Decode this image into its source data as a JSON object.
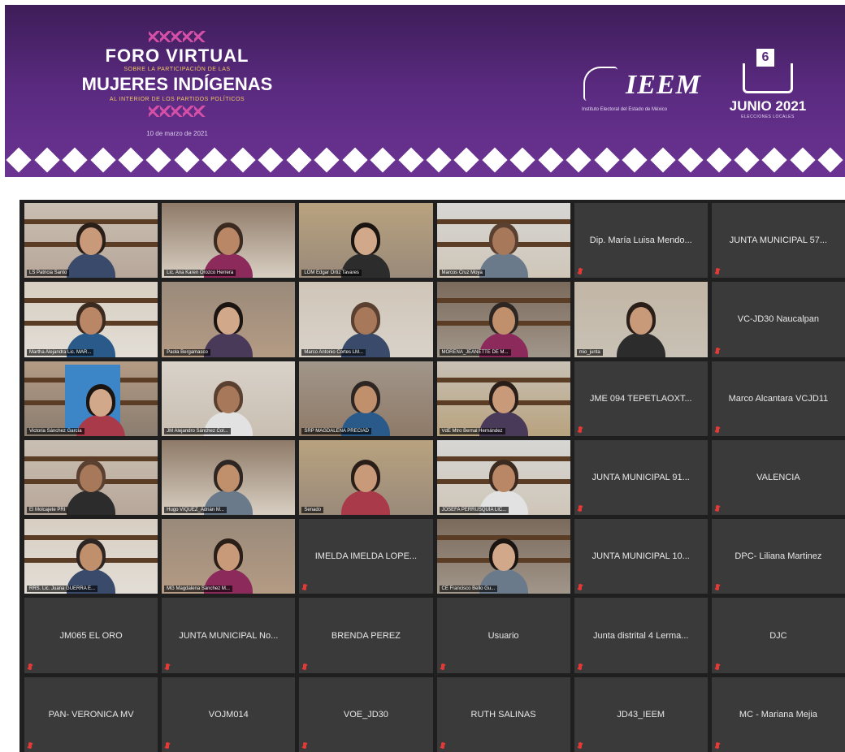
{
  "banner": {
    "foro_title": "FORO VIRTUAL",
    "foro_sub1": "SOBRE LA PARTICIPACIÓN DE LAS",
    "foro_main": "MUJERES INDÍGENAS",
    "foro_sub2": "AL INTERIOR DE LOS PARTIDOS POLÍTICOS",
    "foro_date": "10 de marzo de 2021",
    "ieem_text": "IEEM",
    "ieem_sub": "Instituto Electoral del Estado de México",
    "junio_day": "6",
    "junio_text": "JUNIO 2021",
    "junio_sub": "ELECCIONES LOCALES"
  },
  "colors": {
    "banner_purple": "#5a2a80",
    "tile_bg": "#3a3a3a",
    "grid_bg": "#1f1f1f",
    "active_speaker": "#d6d23a",
    "muted_mic": "#e53935"
  },
  "participants": [
    {
      "name": "LS Patricia Santo",
      "video": true
    },
    {
      "name": "Lic. Ana Karen Orozco Herrera",
      "video": true
    },
    {
      "name": "LOM Edgar Ortiz Tavares",
      "video": true
    },
    {
      "name": "Marcos Cruz Moya",
      "video": true,
      "active": true
    },
    {
      "name": "Dip. María Luisa Mendo...",
      "video": false
    },
    {
      "name": "JUNTA MUNICIPAL 57...",
      "video": false
    },
    {
      "name": "Martha Alejandra Lic. MAR...",
      "video": true
    },
    {
      "name": "Paola Bergamasco",
      "video": true
    },
    {
      "name": "Marco Antonio Cortes LM...",
      "video": true
    },
    {
      "name": "MORENA_JEANETTE DE M...",
      "video": true
    },
    {
      "name": "mio_junta",
      "video": true
    },
    {
      "name": "VC-JD30 Naucalpan",
      "video": false
    },
    {
      "name": "Victoria Sánchez García",
      "video": true
    },
    {
      "name": "JM Alejandro Sánchez Col...",
      "video": true
    },
    {
      "name": "SRP MAGDALENA PRECIAD",
      "video": true
    },
    {
      "name": "VdE Mtro Bernal Hernández",
      "video": true
    },
    {
      "name": "JME 094 TEPETLAOXT...",
      "video": false
    },
    {
      "name": "Marco Alcantara VCJD11",
      "video": false
    },
    {
      "name": "El Molcajete PRI",
      "video": true
    },
    {
      "name": "Hugo VIQUEZ_Adrián M...",
      "video": true
    },
    {
      "name": "Senado",
      "video": true
    },
    {
      "name": "JOSEFA PERRUSQUÍA LIC...",
      "video": true
    },
    {
      "name": "JUNTA MUNICIPAL 91...",
      "video": false
    },
    {
      "name": "VALENCIA",
      "video": false
    },
    {
      "name": "RRS. Lic. Juana GUERRA E...",
      "video": true
    },
    {
      "name": "MG Magdalena Sánchez M...",
      "video": true
    },
    {
      "name": "IMELDA IMELDA LOPE...",
      "video": false
    },
    {
      "name": "CE Francisco Bello Gu...",
      "video": true
    },
    {
      "name": "JUNTA MUNICIPAL 10...",
      "video": false
    },
    {
      "name": "DPC- Liliana Martinez",
      "video": false
    },
    {
      "name": "JM065 EL ORO",
      "video": false
    },
    {
      "name": "JUNTA MUNICIPAL No...",
      "video": false
    },
    {
      "name": "BRENDA PEREZ",
      "video": false
    },
    {
      "name": "Usuario",
      "video": false
    },
    {
      "name": "Junta distrital 4 Lerma...",
      "video": false
    },
    {
      "name": "DJC",
      "video": false
    },
    {
      "name": "PAN- VERONICA MV",
      "video": false
    },
    {
      "name": "VOJM014",
      "video": false
    },
    {
      "name": "VOE_JD30",
      "video": false
    },
    {
      "name": "RUTH SALINAS",
      "video": false
    },
    {
      "name": "JD43_IEEM",
      "video": false
    },
    {
      "name": "MC - Mariana Mejia",
      "video": false
    }
  ]
}
